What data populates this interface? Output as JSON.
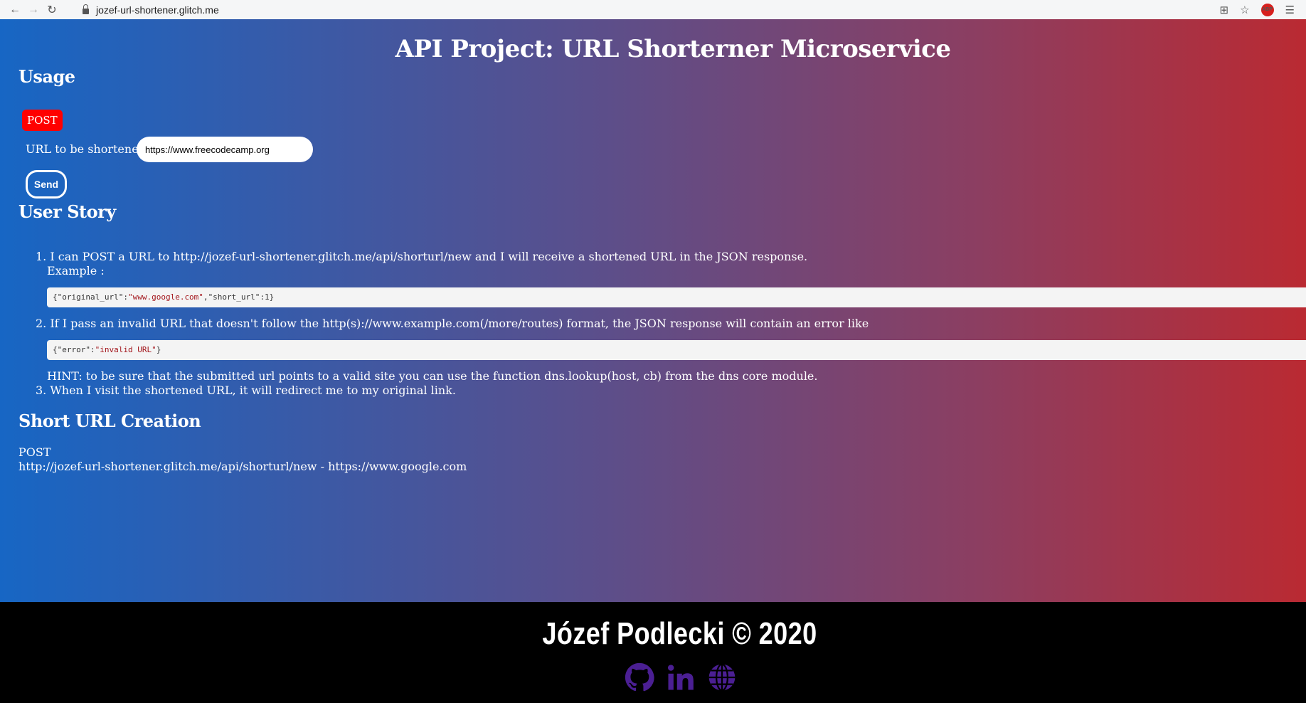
{
  "browser": {
    "url": "jozef-url-shortener.glitch.me",
    "abp_label": "ABP"
  },
  "page": {
    "title": "API Project: URL Shorterner Microservice"
  },
  "usage": {
    "heading": "Usage",
    "method_badge": "POST",
    "input_label": "URL to be shortened",
    "input_value": "https://www.freecodecamp.org",
    "send_label": "Send"
  },
  "user_story": {
    "heading": "User Story",
    "items": [
      {
        "number": "1.",
        "text": "I can POST a URL to http://jozef-url-shortener.glitch.me/api/shorturl/new and I will receive a shortened URL in the JSON response.",
        "subtext": "Example :",
        "code": "{\"original_url\":\"www.google.com\",\"short_url\":1}"
      },
      {
        "number": "2.",
        "text": "If I pass an invalid URL that doesn't follow the http(s)://www.example.com(/more/routes) format, the JSON response will contain an error like",
        "code": "{\"error\":\"invalid URL\"}",
        "hint": "HINT: to be sure that the submitted url points to a valid site you can use the function dns.lookup(host, cb) from the dns core module."
      },
      {
        "number": "3.",
        "text": "When I visit the shortened URL, it will redirect me to my original link."
      }
    ]
  },
  "creation": {
    "heading": "Short URL Creation",
    "method": "POST",
    "example": "http://jozef-url-shortener.glitch.me/api/shorturl/new - https://www.google.com"
  },
  "footer": {
    "name": "Józef Podlecki © 2020",
    "icon_color": "#4b1f93",
    "icons": [
      "github-icon",
      "linkedin-icon",
      "globe-icon"
    ]
  },
  "colors": {
    "gradient_left": "#1766c4",
    "gradient_right": "#ba2a32",
    "badge": "#ff0000"
  }
}
